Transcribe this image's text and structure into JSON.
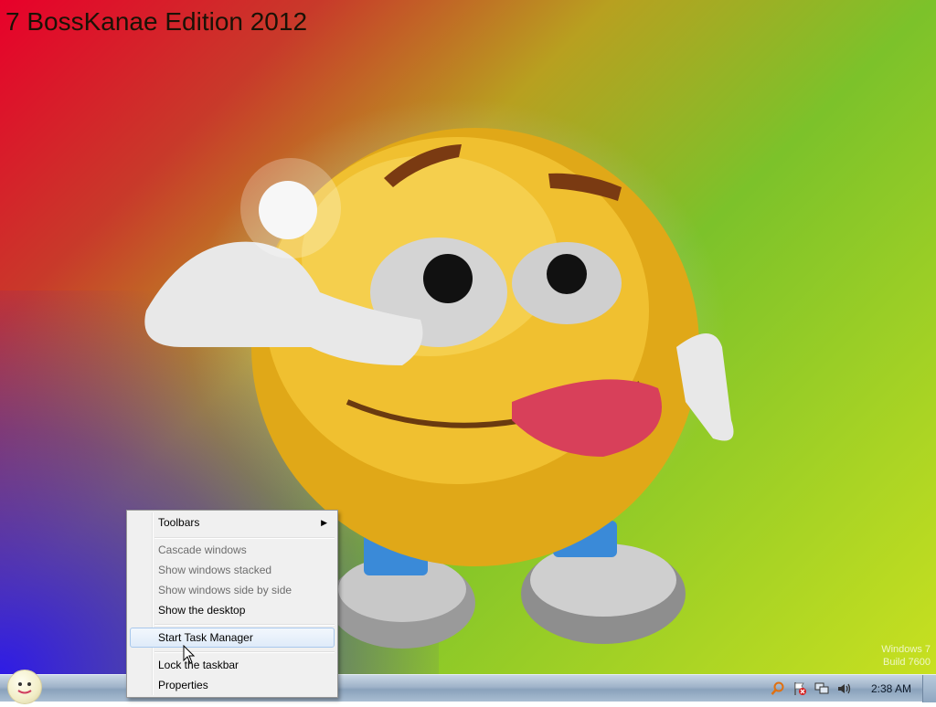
{
  "wallpaper": {
    "title": "7 BossKanae Edition 2012",
    "watermark_line1": "Windows 7",
    "watermark_line2": "Build 7600"
  },
  "context_menu": {
    "toolbars": "Toolbars",
    "cascade": "Cascade windows",
    "stacked": "Show windows stacked",
    "side_by_side": "Show windows side by side",
    "show_desktop": "Show the desktop",
    "task_manager": "Start Task Manager",
    "lock_taskbar": "Lock the taskbar",
    "properties": "Properties"
  },
  "taskbar": {
    "clock": "2:38 AM"
  },
  "icons": {
    "start": "start-orb-icon",
    "search": "search-icon",
    "action_center": "action-center-flag-icon",
    "network": "network-icon",
    "volume": "volume-icon",
    "submenu": "chevron-right-icon"
  },
  "colors": {
    "taskbar": "#9fb3c9",
    "menu_bg": "#f0f0f0",
    "menu_hover_border": "#a8c8ec",
    "disabled_text": "#6d6d6d"
  }
}
